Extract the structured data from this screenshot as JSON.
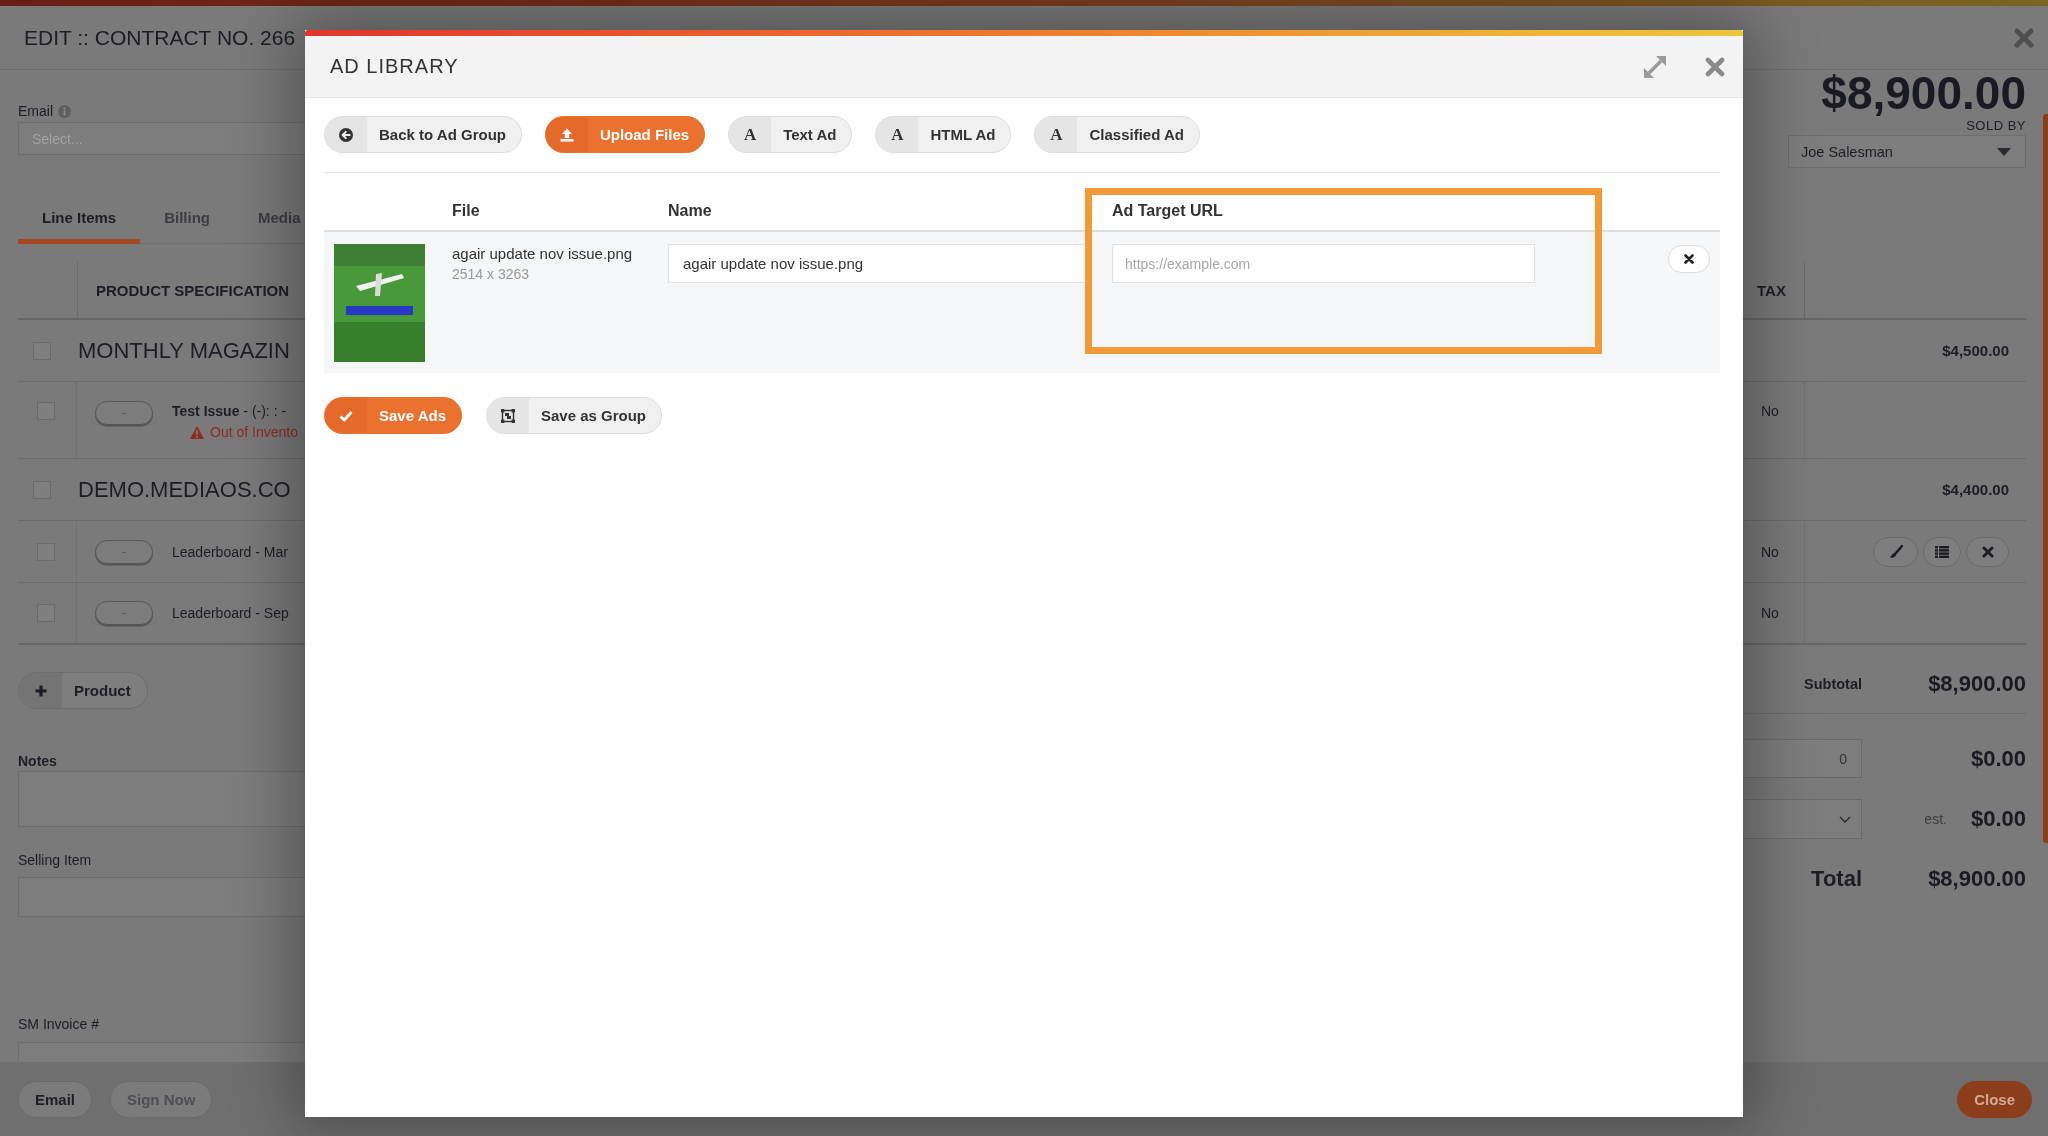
{
  "page": {
    "title": "EDIT :: CONTRACT NO. 266",
    "contract_total": "$8,900.00",
    "email": {
      "label": "Email",
      "placeholder": "Select..."
    },
    "sold_by": {
      "label": "SOLD BY",
      "value": "Joe Salesman"
    },
    "tabs": [
      {
        "label": "Line Items",
        "selected": true
      },
      {
        "label": "Billing",
        "selected": false
      },
      {
        "label": "Media",
        "selected": false
      }
    ],
    "line_items": {
      "columns": [
        "PRODUCT SPECIFICATION",
        "TAX"
      ],
      "rows": [
        {
          "kind": "group",
          "checked": false,
          "title": "MONTHLY MAGAZIN",
          "amount": "$4,500.00"
        },
        {
          "kind": "item",
          "checked": false,
          "toggle": "-",
          "title": "**Test Issue** - (-): : -",
          "warning": "Out of Invento",
          "tax": "No",
          "show_actions": false
        },
        {
          "kind": "group",
          "checked": false,
          "title": "DEMO.MEDIAOS.CO",
          "amount": "$4,400.00"
        },
        {
          "kind": "item",
          "checked": false,
          "toggle": "-",
          "title": "Leaderboard - Mar",
          "tax": "No",
          "show_actions": true
        },
        {
          "kind": "item",
          "checked": false,
          "toggle": "-",
          "title": "Leaderboard - Sep",
          "tax": "No",
          "show_actions": false
        }
      ]
    },
    "add_product_button": "Product",
    "notes": {
      "label": "Notes"
    },
    "selling_item": {
      "label": "Selling Item"
    },
    "sm_invoice": {
      "label": "SM Invoice #"
    },
    "totals": {
      "subtotal_label": "Subtotal",
      "subtotal": "$8,900.00",
      "discount_value": "0",
      "discount": "$0.00",
      "tax_note": "est.",
      "tax": "$0.00",
      "total_label": "Total",
      "total": "$8,900.00"
    },
    "footer": {
      "buttons": [
        {
          "label": "Email",
          "disabled": false
        },
        {
          "label": "Sign Now",
          "disabled": true
        }
      ],
      "close_button": "Close"
    }
  },
  "modal": {
    "title": "AD LIBRARY",
    "toolbar": [
      {
        "kind": "back",
        "label": "Back to Ad Group",
        "primary": false
      },
      {
        "kind": "upload",
        "label": "Upload Files",
        "primary": true
      },
      {
        "kind": "glyph",
        "glyph": "A",
        "label": "Text Ad",
        "primary": false
      },
      {
        "kind": "glyph",
        "glyph": "A",
        "label": "HTML Ad",
        "primary": false
      },
      {
        "kind": "glyph",
        "glyph": "A",
        "label": "Classified Ad",
        "primary": false
      }
    ],
    "table": {
      "columns": [
        {
          "label": "File",
          "highlighted": false
        },
        {
          "label": "Name",
          "highlighted": false
        },
        {
          "label": "Ad Target URL",
          "highlighted": true
        }
      ],
      "rows": [
        {
          "file_name": "agair update nov issue.png",
          "dimensions": "2514 x 3263",
          "name": "agair update nov issue.png",
          "target_url_placeholder": "https://example.com"
        }
      ]
    },
    "actions": [
      {
        "kind": "save",
        "label": "Save Ads",
        "primary": true
      },
      {
        "kind": "group",
        "label": "Save as Group",
        "primary": false
      }
    ]
  }
}
